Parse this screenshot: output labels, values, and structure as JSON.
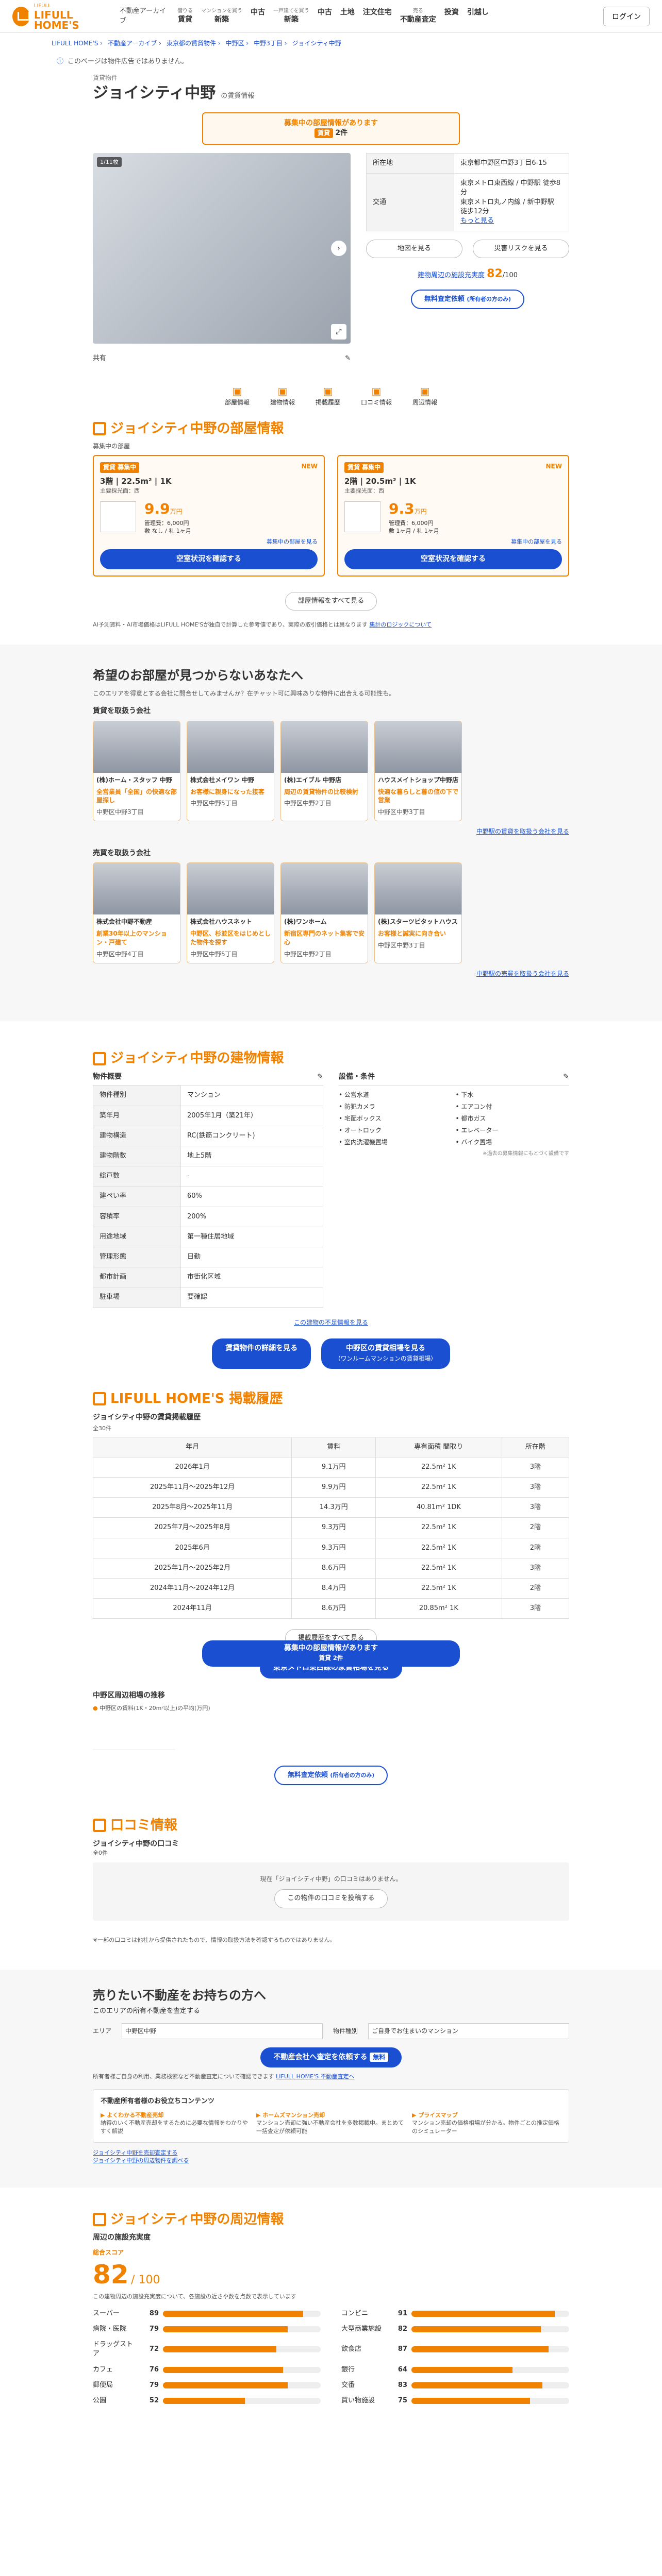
{
  "header": {
    "logo": "LIFULL HOME'S",
    "logo_sub": "LIFULL",
    "site": "不動産アーカイブ",
    "login": "ログイン",
    "nav": [
      {
        "sub": "借りる",
        "label": "賃貸"
      },
      {
        "sub": "マンションを買う",
        "label": "新築"
      },
      {
        "sub": "",
        "label": "中古"
      },
      {
        "sub": "一戸建てを買う",
        "label": "新築"
      },
      {
        "sub": "",
        "label": "中古"
      },
      {
        "sub": "",
        "label": "土地"
      },
      {
        "sub": "",
        "label": "注文住宅"
      },
      {
        "sub": "売る",
        "label": "不動産査定"
      },
      {
        "sub": "",
        "label": "投資"
      },
      {
        "sub": "",
        "label": "引越し"
      }
    ]
  },
  "breadcrumb": [
    "LIFULL HOME'S",
    "不動産アーカイブ",
    "東京都の賃貸物件",
    "中野区",
    "中野3丁目",
    "ジョイシティ中野"
  ],
  "notice": {
    "text": "このページは物件広告ではありません。"
  },
  "building": {
    "tag": "賃貸物件",
    "name": "ジョイシティ中野",
    "type": "の賃貸情報",
    "img_count": "1/11枚",
    "recruit": {
      "line1": "募集中の部屋情報があります",
      "badge": "賃貸",
      "count": "2件"
    },
    "address_label": "所在地",
    "address": "東京都中野区中野3丁目6-15",
    "access_label": "交通",
    "access": [
      "東京メトロ東西線 / 中野駅 徒歩8分",
      "東京メトロ丸ノ内線 / 新中野駅 徒歩12分"
    ],
    "access_more": "もっと見る",
    "map_btn": "地図を見る",
    "hazard_btn": "災害リスクを見る",
    "score_label": "建物周辺の施設充実度",
    "score": "82",
    "score_total": "/100",
    "appraisal_btn": "無料査定依頼",
    "appraisal_sub": "(所有者の方のみ)",
    "tabs": [
      "部屋情報",
      "建物情報",
      "掲載履歴",
      "口コミ情報",
      "周辺情報"
    ],
    "share_label": "共有"
  },
  "rooms": {
    "title": "ジョイシティ中野の部屋情報",
    "sub": "募集中の部屋",
    "items": [
      {
        "tag": "賃貸",
        "status": "募集中",
        "new": "NEW",
        "floor": "3階",
        "size": "22.5m²",
        "layout": "1K",
        "direction": "主要採光面：西",
        "rent": "9.9",
        "unit": "万円",
        "fee": "管理費：6,000円",
        "deposit": "敷 なし",
        "key": "礼 1ヶ月",
        "more": "募集中の部屋を見る",
        "btn": "空室状況を確認する"
      },
      {
        "tag": "賃貸",
        "status": "募集中",
        "new": "NEW",
        "floor": "2階",
        "size": "20.5m²",
        "layout": "1K",
        "direction": "主要採光面：西",
        "rent": "9.3",
        "unit": "万円",
        "fee": "管理費：6,000円",
        "deposit": "敷 1ヶ月",
        "key": "礼 1ヶ月",
        "more": "募集中の部屋を見る",
        "btn": "空室状況を確認する"
      }
    ],
    "all_btn": "部屋情報をすべて見る",
    "note": "AI予測賃料・AI市場価格はLIFULL HOME'Sが独自で計算した参考値であり、実際の取引価格とは異なります",
    "note_link": "賃料については",
    "note_link2": "集計のロジックについて"
  },
  "agents": {
    "title": "希望のお部屋が見つからないあなたへ",
    "sub": "このエリアを得意とする会社に問合せしてみませんか？在チャット可に興味ありな物件に出合える可能性も。",
    "rent_title": "賃貸を取扱う会社",
    "rent_shops": [
      {
        "name": "(株)ホーム・スタッフ 中野",
        "copy": "全営業員「全国」の快適な部屋探し",
        "addr": "中野区中野3丁目"
      },
      {
        "name": "株式会社メイワン 中野",
        "copy": "お客様に親身になった接客",
        "addr": "中野区中野5丁目"
      },
      {
        "name": "(株)エイブル 中野店",
        "copy": "周辺の賃貸物件の比較検討",
        "addr": "中野区中野2丁目"
      },
      {
        "name": "ハウスメイトショップ中野店",
        "copy": "快適な暮らしと暮の値の下で営業",
        "addr": "中野区中野3丁目"
      }
    ],
    "rent_link": "中野駅の賃貸を取扱う会社を見る",
    "sale_title": "売買を取扱う会社",
    "sale_shops": [
      {
        "name": "株式会社中野不動産",
        "copy": "創業30年以上のマンション・戸建て",
        "addr": "中野区中野4丁目"
      },
      {
        "name": "株式会社ハウスネット",
        "copy": "中野区、杉並区をはじめとした物件を探す",
        "addr": "中野区中野5丁目"
      },
      {
        "name": "(株)ワンホーム",
        "copy": "新宿区専門のネット集客で安心",
        "addr": "中野区中野2丁目"
      },
      {
        "name": "(株)スターツピタットハウス",
        "copy": "お客様と誠実に向き合い",
        "addr": "中野区中野3丁目"
      }
    ],
    "sale_link": "中野駅の売買を取扱う会社を見る"
  },
  "info": {
    "title": "ジョイシティ中野の建物情報",
    "outline_title": "物件概要",
    "equip_title": "設備・条件",
    "rows": [
      [
        "物件種別",
        "マンション"
      ],
      [
        "築年月",
        "2005年1月（築21年）"
      ],
      [
        "建物構造",
        "RC(鉄筋コンクリート)"
      ],
      [
        "建物階数",
        "地上5階"
      ],
      [
        "総戸数",
        "-"
      ],
      [
        "建ぺい率",
        "60%"
      ],
      [
        "容積率",
        "200%"
      ],
      [
        "用途地域",
        "第一種住居地域"
      ],
      [
        "管理形態",
        "日勤"
      ],
      [
        "都市計画",
        "市街化区域"
      ],
      [
        "駐車場",
        "要確認"
      ]
    ],
    "equip": [
      "公営水道",
      "下水",
      "防犯カメラ",
      "エアコン付",
      "宅配ボックス",
      "都市ガス",
      "オートロック",
      "エレベーター",
      "室内洗濯機置場",
      "バイク置場"
    ],
    "equip_note": "※過去の募集情報にもとづく設備です",
    "more": "この建物の不足情報を見る",
    "btn1": "賃貸物件の詳細を見る",
    "btn2": "中野区の賃貸相場を見る",
    "btn2_sub": "（ワンルームマンションの賃貸相場）"
  },
  "history": {
    "title": "LIFULL HOME'S 掲載履歴",
    "sub": "ジョイシティ中野の賃貸掲載履歴",
    "count": "全30件",
    "head": [
      "年月",
      "賃料",
      "専有面積\n間取り",
      "所在階"
    ],
    "rows": [
      [
        "2026年1月",
        "9.1万円",
        "22.5m²",
        "1K",
        "3階"
      ],
      [
        "2025年11月〜2025年12月",
        "9.9万円",
        "22.5m²",
        "1K",
        "3階"
      ],
      [
        "2025年8月〜2025年11月",
        "14.3万円",
        "40.81m²",
        "1DK",
        "3階"
      ],
      [
        "2025年7月〜2025年8月",
        "9.3万円",
        "22.5m²",
        "1K",
        "2階"
      ],
      [
        "2025年6月",
        "9.3万円",
        "22.5m²",
        "1K",
        "2階"
      ],
      [
        "2025年1月〜2025年2月",
        "8.6万円",
        "22.5m²",
        "1K",
        "3階"
      ],
      [
        "2024年11月〜2024年12月",
        "8.4万円",
        "22.5m²",
        "1K",
        "2階"
      ],
      [
        "2024年11月",
        "8.6万円",
        "20.85m²",
        "1K",
        "3階"
      ]
    ],
    "overlay_btn": "募集中の部屋情報があります",
    "overlay_sub": "賃貸 2件",
    "all_btn": "掲載履歴をすべて見る",
    "metro_btn": "東京メトロ東西線の家賃相場を見る",
    "trend_title": "中野区周辺相場の推移",
    "trend_legend": "中野区の賃料(1K・20m²以上)の平均(万円)",
    "appraisal_btn": "無料査定依頼",
    "appraisal_sub": "(所有者の方のみ)"
  },
  "review": {
    "title": "口コミ情報",
    "sub": "ジョイシティ中野の口コミ",
    "count": "全0件",
    "empty": "現在「ジョイシティ中野」の口コミはありません。",
    "post_btn": "この物件の口コミを投稿する",
    "note": "※一部の口コミは他社から提供されたもので、情報の取扱方法を確認するものではありません。"
  },
  "sell": {
    "title": "売りたい不動産をお持ちの方へ",
    "sub": "このエリアの所有不動産を査定する",
    "area_label": "エリア",
    "area": "中野区中野",
    "type_label": "物件種別",
    "type_value": "ご自身でお住まいのマンション",
    "btn": "不動産会社へ査定を依頼する",
    "badge": "無料",
    "note": "所有者様ご自身の利用、業務検索など不動産査定について確認できます",
    "note_link": "LIFULL HOME'S 不動産査定へ",
    "content_title": "不動産所有者様のお役立ちコンテンツ",
    "contents": [
      {
        "t": "よくわかる不動産売却",
        "d": "納得のいく不動産売却をするために必要な情報をわかりやすく解説"
      },
      {
        "t": "ホームズマンション売却",
        "d": "マンション売却に強い不動産会社を多数掲載中。まとめて一括査定が依頼可能"
      },
      {
        "t": "プライスマップ",
        "d": "マンション売却の価格相場が分かる。物件ごとの推定価格のシミュレーター"
      }
    ],
    "links": [
      "ジョイシティ中野を売却査定する",
      "ジョイシティ中野の周辺物件を調べる"
    ]
  },
  "nearby": {
    "title": "ジョイシティ中野の周辺情報",
    "sub": "周辺の施設充実度",
    "score_label": "総合スコア",
    "score": "82",
    "total": "/ 100",
    "desc": "この建物周辺の施設充実度について、各施設の近さや数を点数で表示しています",
    "items": [
      {
        "n": "スーパー",
        "s": "89",
        "c": "コンビニ",
        "cs": "91"
      },
      {
        "n": "病院・医院",
        "s": "79",
        "c": "大型商業施設",
        "cs": "82"
      },
      {
        "n": "ドラッグストア",
        "s": "72",
        "c": "飲食店",
        "cs": "87"
      },
      {
        "n": "カフェ",
        "s": "76",
        "c": "銀行",
        "cs": "64"
      },
      {
        "n": "郵便局",
        "s": "79",
        "c": "交番",
        "cs": "83"
      },
      {
        "n": "公園",
        "s": "52",
        "c": "買い物施設",
        "cs": "75"
      }
    ]
  },
  "colors": {
    "accent": "#f08200",
    "blue": "#1a4fd1"
  }
}
